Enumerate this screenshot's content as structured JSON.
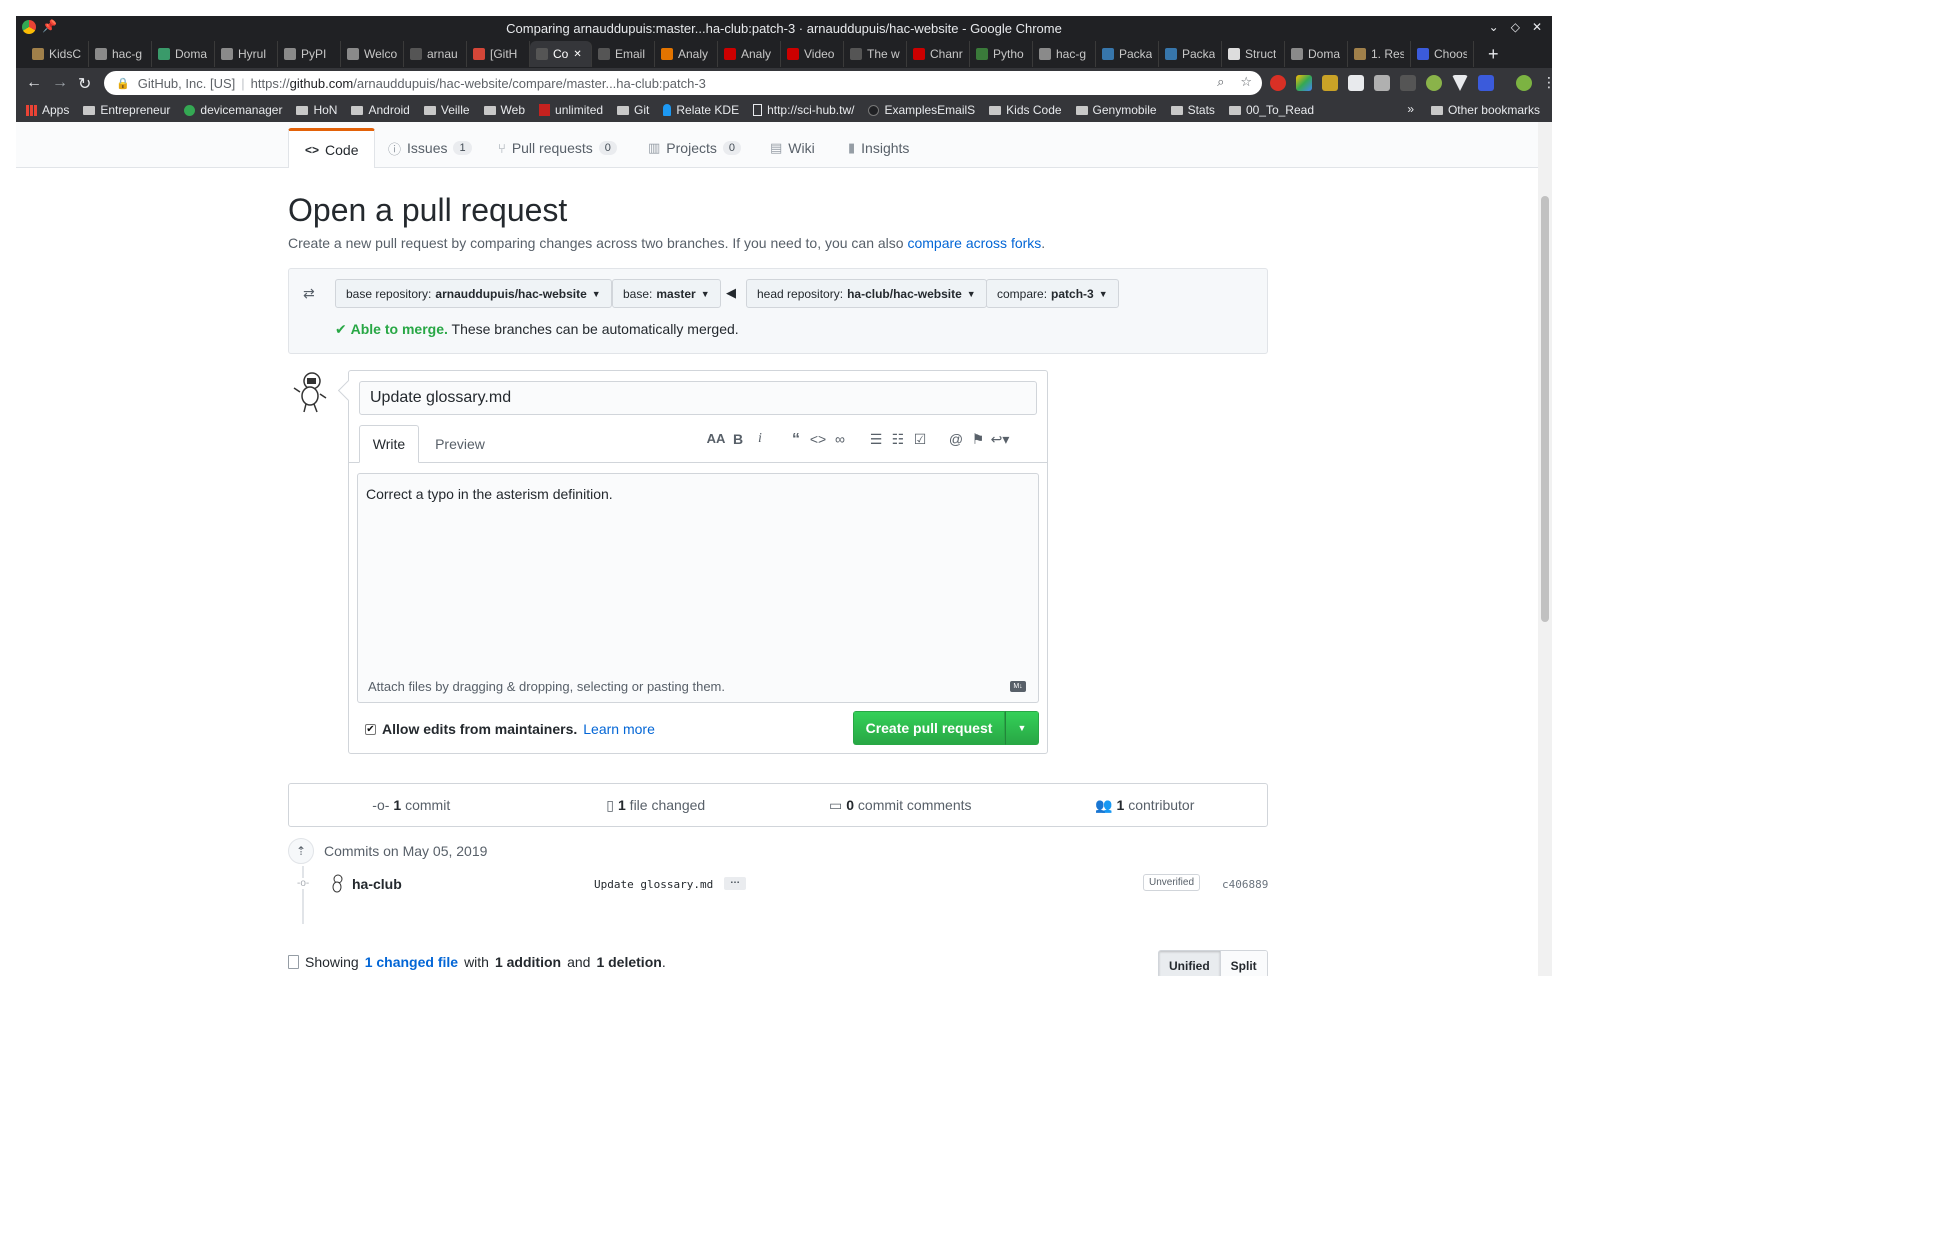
{
  "window": {
    "title": "Comparing arnauddupuis:master...ha-club:patch-3 · arnauddupuis/hac-website - Google Chrome"
  },
  "tabs": [
    {
      "label": "KidsC",
      "color": "#a0804a"
    },
    {
      "label": "hac-g",
      "color": "#8a8a8a"
    },
    {
      "label": "Doma",
      "color": "#3a9a6a"
    },
    {
      "label": "Hyrul",
      "color": "#8a8a8a"
    },
    {
      "label": "PyPI",
      "color": "#8a8a8a"
    },
    {
      "label": "Welco",
      "color": "#8a8a8a"
    },
    {
      "label": "arnau",
      "color": "#555555"
    },
    {
      "label": "[GitH",
      "color": "#d44638"
    },
    {
      "label": "Co",
      "color": "#555555",
      "active": true
    },
    {
      "label": "Email",
      "color": "#555555"
    },
    {
      "label": "Analy",
      "color": "#e37400"
    },
    {
      "label": "Analy",
      "color": "#cc0000"
    },
    {
      "label": "Video",
      "color": "#cc0000"
    },
    {
      "label": "The w",
      "color": "#555555"
    },
    {
      "label": "Chanr",
      "color": "#cc0000"
    },
    {
      "label": "Pytho",
      "color": "#3a7a3a"
    },
    {
      "label": "hac-g",
      "color": "#8a8a8a"
    },
    {
      "label": "Packa",
      "color": "#3776ab"
    },
    {
      "label": "Packa",
      "color": "#3776ab"
    },
    {
      "label": "Struct",
      "color": "#dddddd"
    },
    {
      "label": "Doma",
      "color": "#8a8a8a"
    },
    {
      "label": "1. Res",
      "color": "#a0804a"
    },
    {
      "label": "Choos",
      "color": "#3b5bdb"
    }
  ],
  "toolbar": {
    "site_info": "GitHub, Inc. [US]",
    "url_prefix": "https://",
    "url_host": "github.com",
    "url_path": "/arnauddupuis/hac-website/compare/master...ha-club:patch-3"
  },
  "bookmarks": [
    {
      "label": "Apps",
      "icon": "apps-grid-icon"
    },
    {
      "label": "Entrepreneur",
      "icon": "folder-icon"
    },
    {
      "label": "devicemanager",
      "icon": "circle-icon"
    },
    {
      "label": "HoN",
      "icon": "folder-icon"
    },
    {
      "label": "Android",
      "icon": "folder-icon"
    },
    {
      "label": "Veille",
      "icon": "folder-icon"
    },
    {
      "label": "Web",
      "icon": "folder-icon"
    },
    {
      "label": "unlimited",
      "icon": "m-icon"
    },
    {
      "label": "Git",
      "icon": "folder-icon"
    },
    {
      "label": "Relate KDE",
      "icon": "kde-icon"
    },
    {
      "label": "http://sci-hub.tw/",
      "icon": "page-icon"
    },
    {
      "label": "ExamplesEmailS",
      "icon": "github-icon"
    },
    {
      "label": "Kids Code",
      "icon": "folder-icon"
    },
    {
      "label": "Genymobile",
      "icon": "folder-icon"
    },
    {
      "label": "Stats",
      "icon": "folder-icon"
    },
    {
      "label": "00_To_Read",
      "icon": "folder-icon"
    }
  ],
  "bookmarks_other": "Other bookmarks",
  "bookmarks_more": "»",
  "repo_nav": {
    "code": "Code",
    "issues": "Issues",
    "issues_count": "1",
    "pulls": "Pull requests",
    "pulls_count": "0",
    "projects": "Projects",
    "projects_count": "0",
    "wiki": "Wiki",
    "insights": "Insights"
  },
  "heading": "Open a pull request",
  "subtitle_text": "Create a new pull request by comparing changes across two branches. If you need to, you can also ",
  "subtitle_link": "compare across forks",
  "subtitle_end": ".",
  "range": {
    "base_repo_label": "base repository:",
    "base_repo": "arnauddupuis/hac-website",
    "base_label": "base:",
    "base": "master",
    "head_repo_label": "head repository:",
    "head_repo": "ha-club/hac-website",
    "compare_label": "compare:",
    "compare": "patch-3",
    "merge_ok": "Able to merge.",
    "merge_text": " These branches can be automatically merged."
  },
  "form": {
    "title_value": "Update glossary.md",
    "tab_write": "Write",
    "tab_preview": "Preview",
    "body_value": "Correct a typo in the asterism definition.",
    "attach_text": "Attach files by dragging & dropping, selecting or pasting them.",
    "md_badge": "M↓",
    "allow_edits": "Allow edits from maintainers.",
    "learn_more": "Learn more",
    "allow_edits_checked": true,
    "create_button": "Create pull request"
  },
  "summary": {
    "commits_num": "1",
    "commits_label": " commit",
    "files_num": "1",
    "files_label": " file changed",
    "comments_num": "0",
    "comments_label": " commit comments",
    "contrib_num": "1",
    "contrib_label": " contributor"
  },
  "commits": {
    "date_header": "Commits on May 05, 2019",
    "rows": [
      {
        "author": "ha-club",
        "message": "Update glossary.md",
        "ellipsis": "…",
        "badge": "Unverified",
        "sha": "c406889"
      }
    ]
  },
  "files": {
    "showing": "Showing",
    "changed_link": "1 changed file",
    "with": "with",
    "additions": "1 addition",
    "and": "and",
    "deletions": "1 deletion",
    "end": ".",
    "unified": "Unified",
    "split": "Split"
  }
}
